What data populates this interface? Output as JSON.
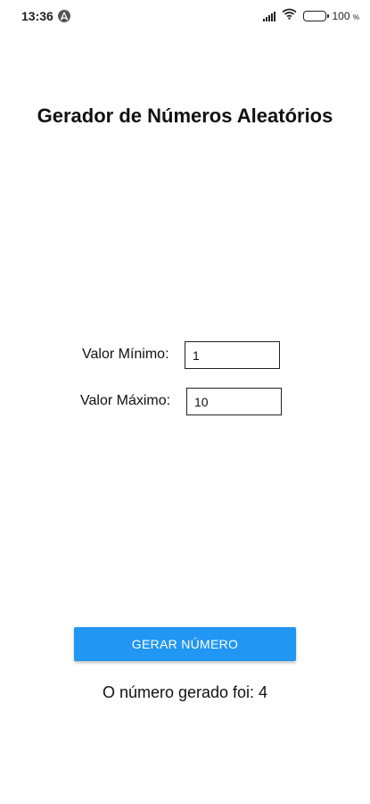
{
  "status_bar": {
    "time": "13:36",
    "battery_percent": "100",
    "battery_unit": "%",
    "app_icon": "arch-linux-icon",
    "icons": [
      "signal-icon",
      "wifi-icon",
      "battery-icon"
    ]
  },
  "page": {
    "title": "Gerador de Números Aleatórios"
  },
  "form": {
    "min_label": "Valor Mínimo:",
    "min_value": "1",
    "max_label": "Valor Máximo:",
    "max_value": "10"
  },
  "actions": {
    "generate_label": "GERAR NÚMERO"
  },
  "result": {
    "text": "O número gerado foi: 4"
  },
  "colors": {
    "button_bg": "#2196f3",
    "button_text": "#ffffff",
    "background": "#ffffff"
  }
}
